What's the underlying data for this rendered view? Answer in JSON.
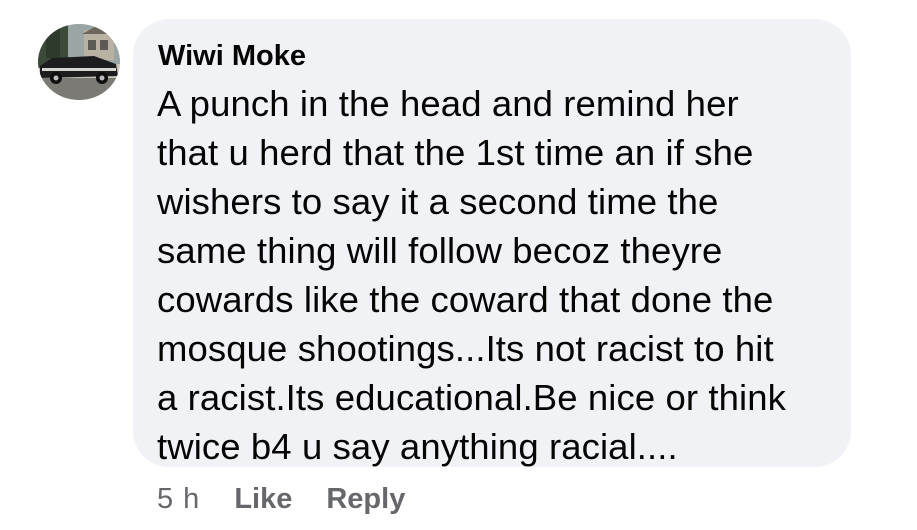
{
  "comment": {
    "author": "Wiwi Moke",
    "text": "A punch in the head and remind her that u herd that the 1st time an if she wishers to say it a second time the same thing will follow becoz theyre cowards like the coward that done the mosque shootings...Its not racist to hit a racist.Its educational.Be nice or think twice b4 u say anything racial....",
    "text_lines": [
      "A punch in the head and remind her",
      "that u herd that the 1st time an if she",
      "wishers to say it a second time the",
      "same thing will follow becoz theyre",
      "cowards like the coward that done the",
      "mosque shootings...Its not racist to hit",
      "a racist.Its educational.Be nice or think",
      "twice b4 u say anything racial...."
    ],
    "time": "5 h",
    "like_label": "Like",
    "reply_label": "Reply"
  },
  "colors": {
    "bubble_bg": "#f0f2f5",
    "text": "#050505",
    "secondary_text": "#65676b"
  }
}
